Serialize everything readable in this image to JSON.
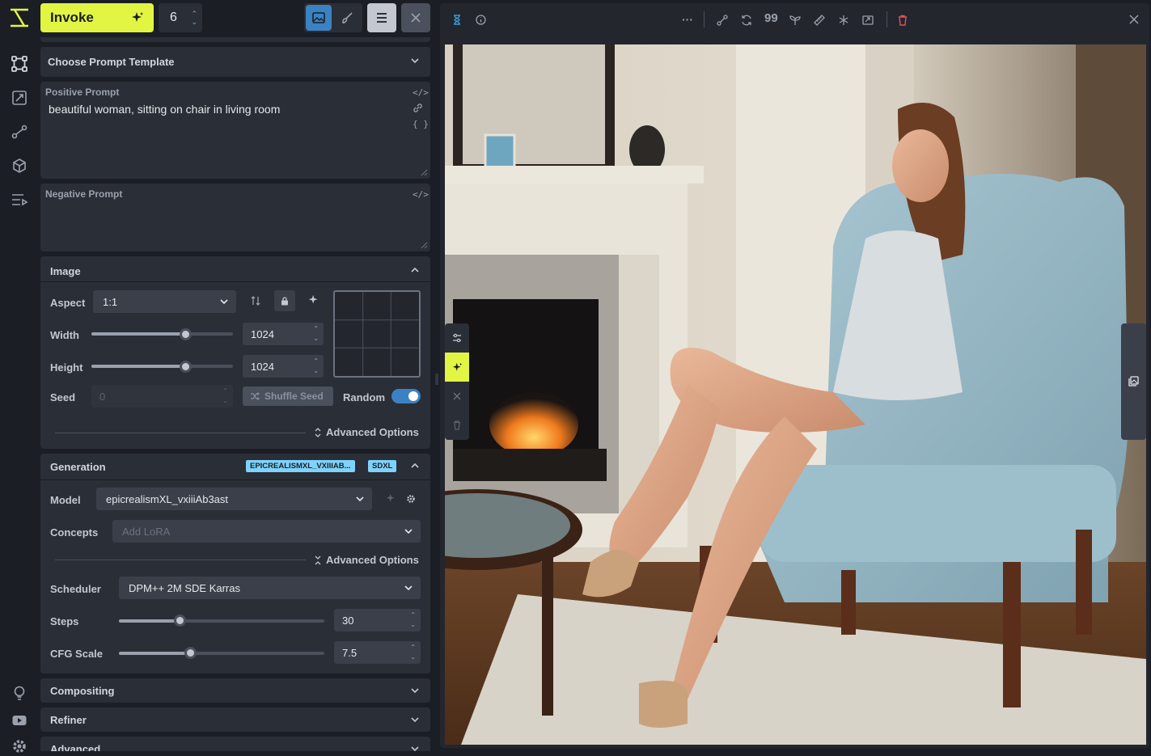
{
  "topbar": {
    "invoke_label": "Invoke",
    "iterations": "6"
  },
  "sections": {
    "prompt_template": "Choose Prompt Template",
    "positive_label": "Positive Prompt",
    "positive_text": "beautiful  woman, sitting on chair in living room",
    "negative_label": "Negative Prompt",
    "image": "Image",
    "generation": "Generation",
    "compositing": "Compositing",
    "refiner": "Refiner",
    "advanced": "Advanced"
  },
  "image": {
    "aspect_label": "Aspect",
    "aspect_value": "1:1",
    "width_label": "Width",
    "width_value": "1024",
    "width_fraction": 0.67,
    "height_label": "Height",
    "height_value": "1024",
    "height_fraction": 0.67,
    "seed_label": "Seed",
    "seed_value": "0",
    "shuffle_label": "Shuffle Seed",
    "random_label": "Random",
    "random_on": true,
    "advanced_label": "Advanced Options"
  },
  "generation": {
    "badge_model": "EPICREALISMXL_VXIIIAB...",
    "badge_base": "SDXL",
    "model_label": "Model",
    "model_value": "epicrealismXL_vxiiiAb3ast",
    "concepts_label": "Concepts",
    "concepts_placeholder": "Add LoRA",
    "advanced_label": "Advanced Options",
    "scheduler_label": "Scheduler",
    "scheduler_value": "DPM++ 2M SDE Karras",
    "steps_label": "Steps",
    "steps_value": "30",
    "steps_fraction": 0.3,
    "cfg_label": "CFG Scale",
    "cfg_value": "7.5",
    "cfg_fraction": 0.35
  },
  "colors": {
    "accent": "#e2f542",
    "active_blue": "#3b82c4",
    "delete_red": "#e05252"
  }
}
